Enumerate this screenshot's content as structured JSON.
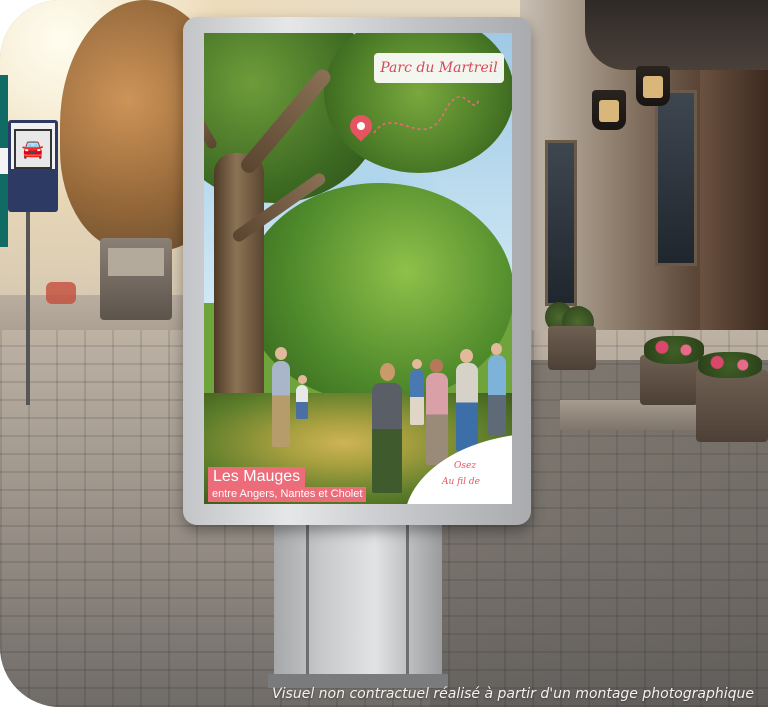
{
  "poster": {
    "location_label": "Parc du Martreil",
    "title": "Les Mauges",
    "subtitle": "entre Angers, Nantes et Cholet",
    "tagline_line1": "Osez",
    "tagline_line2": "Au fil de"
  },
  "caption": "Visuel non contractuel réalisé à partir d'un montage photographique",
  "colors": {
    "brand_pink": "#ec6c7a",
    "pin_red": "#e6545f",
    "teal_accent": "#0f6b63",
    "sign_blue": "#2d3a63"
  },
  "icons": {
    "parking_sign": "car-icon",
    "map_pin": "map-pin-icon"
  }
}
